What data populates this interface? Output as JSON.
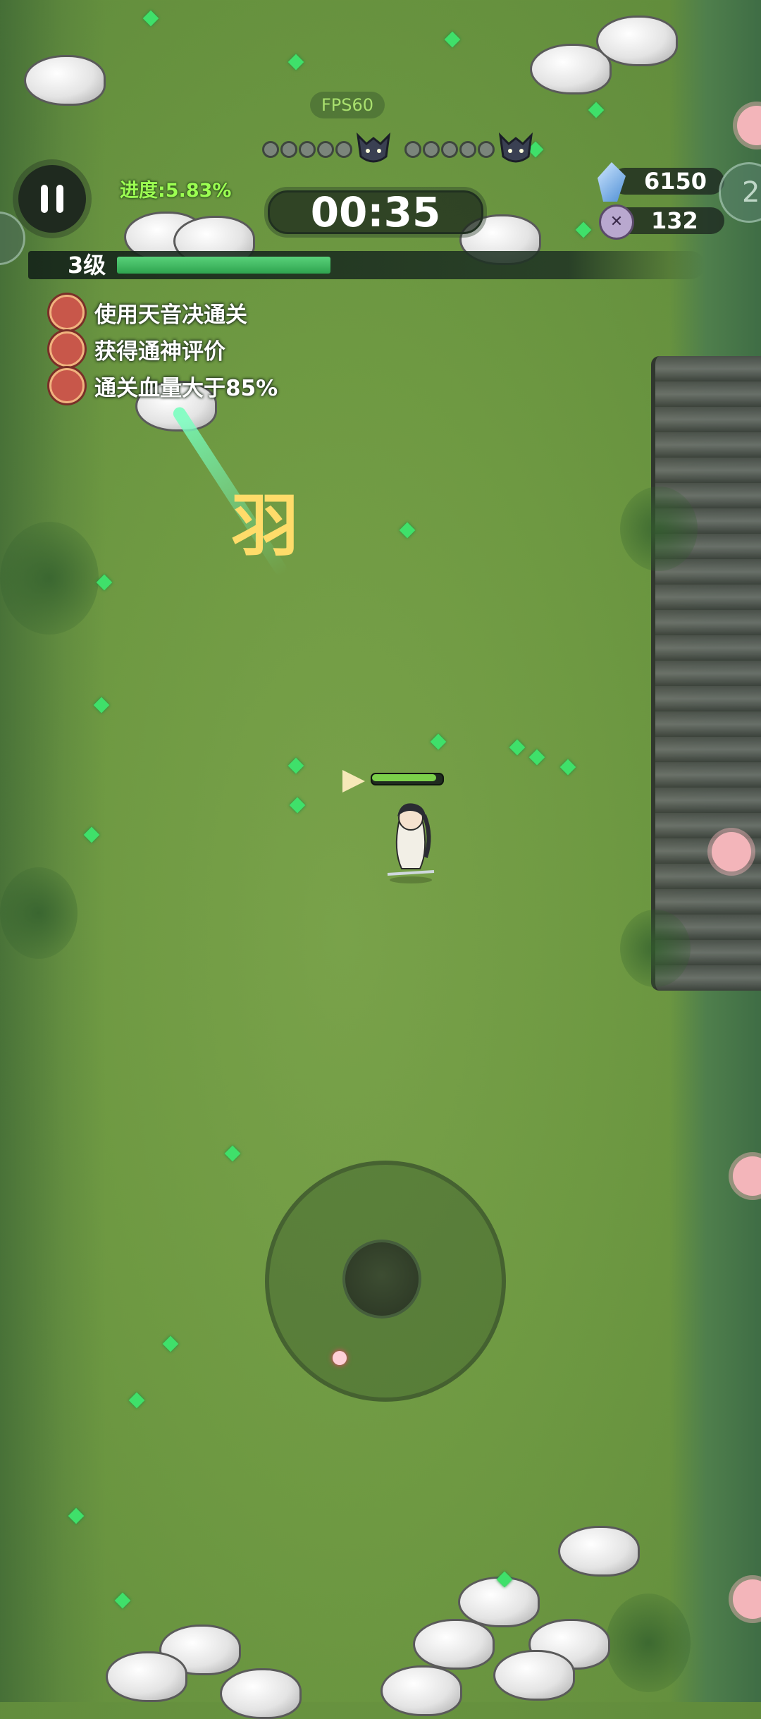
{
  "hud": {
    "fps": "FPS60",
    "progress_label": "进度:5.83%",
    "timer": "00:35",
    "level_label": "3级",
    "level_progress": 0.37,
    "wave_markers": [
      "dot",
      "dot",
      "dot",
      "dot",
      "dot",
      "boss",
      "dot",
      "dot",
      "dot",
      "dot",
      "dot",
      "boss"
    ],
    "crystals": "6150",
    "kills": "132",
    "side_counter": "2"
  },
  "quests": [
    {
      "text": "使用天音决通关",
      "icon": "quest-badge-icon"
    },
    {
      "text": "获得通神评价",
      "icon": "quest-badge-icon"
    },
    {
      "text": "通关血量大于85%",
      "icon": "quest-badge-icon"
    }
  ],
  "world": {
    "rune_char": "羽",
    "player_health": 0.95
  },
  "colors": {
    "grass": "#6e9942",
    "xp_fill": "#2fa34f",
    "progress_text": "#9cff52",
    "gem": "#3fe06a"
  }
}
